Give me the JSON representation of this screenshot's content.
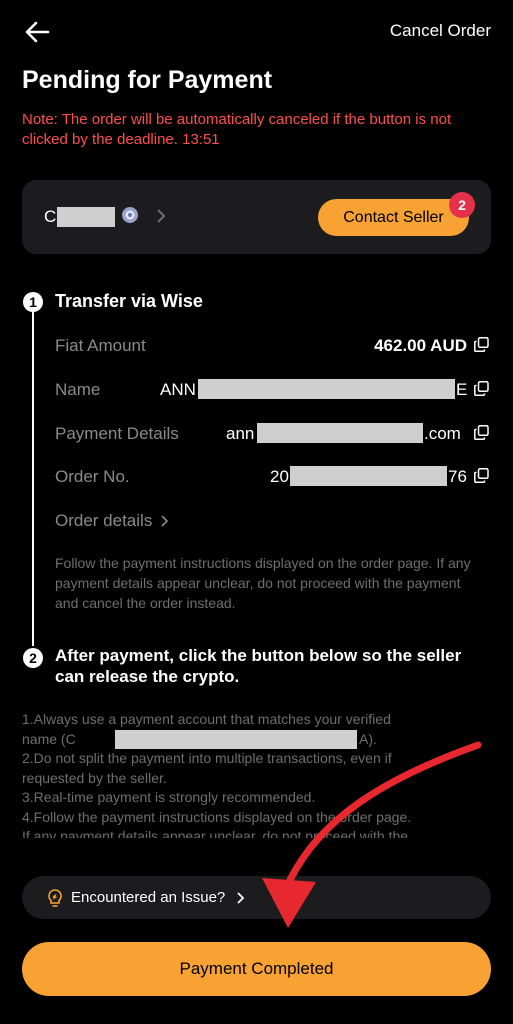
{
  "header": {
    "cancel_label": "Cancel Order",
    "title": "Pending for Payment",
    "note": "Note: The order will be automatically canceled if the button is not clicked by the deadline. 13:51"
  },
  "seller": {
    "name_initial": "C",
    "contact_label": "Contact Seller",
    "badge_count": "2"
  },
  "step1": {
    "number": "1",
    "title": "Transfer via Wise",
    "rows": [
      {
        "label": "Fiat Amount",
        "value": "462.00 AUD"
      },
      {
        "label": "Name",
        "value_prefix": "ANN",
        "value_suffix": "E"
      },
      {
        "label": "Payment Details",
        "value_prefix": "ann",
        "value_suffix": ".com"
      },
      {
        "label": "Order No.",
        "value_prefix": "20",
        "value_suffix": "76"
      }
    ],
    "order_details_label": "Order details",
    "instructions": "Follow the payment instructions displayed on the order page. If any payment details appear unclear, do not proceed with the payment and cancel the order instead."
  },
  "step2": {
    "number": "2",
    "title": "After payment, click the button below so the seller can release the crypto."
  },
  "notes": {
    "line1a": "1.Always use a payment account that matches your verified",
    "line1b_prefix": "name (C",
    "line1b_suffix": "A).",
    "line2a": "2.Do not split the payment into multiple transactions, even if",
    "line2b": "requested by the seller.",
    "line3": "3.Real-time payment is strongly recommended.",
    "line4a": "4.Follow the payment instructions displayed on the order page.",
    "line4b": "If any payment details appear unclear, do not proceed with the"
  },
  "issue_label": "Encountered an Issue?",
  "primary_button_label": "Payment Completed",
  "colors": {
    "accent": "#f7a233",
    "warning": "#ff4d4f",
    "badge": "#e5304a",
    "card": "#1c1c1e",
    "arrow": "#e8282f"
  }
}
